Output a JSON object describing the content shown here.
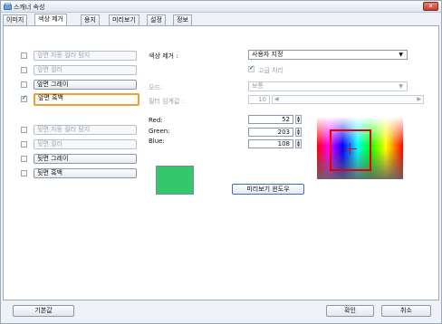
{
  "window": {
    "title": "스캐너 속성",
    "close_label": "✕"
  },
  "tabs": [
    {
      "label": "이미지"
    },
    {
      "label": "색상 제거"
    },
    {
      "label": "용지"
    },
    {
      "label": "미리보기"
    },
    {
      "label": "설정"
    },
    {
      "label": "정보"
    }
  ],
  "options": [
    {
      "label": "앞면 자동 컬러 탐지",
      "checked": false
    },
    {
      "label": "앞면 컬러",
      "checked": false
    },
    {
      "label": "앞면 그레이",
      "checked": false
    },
    {
      "label": "앞면 흑백",
      "checked": true
    },
    {
      "label": "뒷면 자동 컬러 탐지",
      "checked": false
    },
    {
      "label": "뒷면 컬러",
      "checked": false
    },
    {
      "label": "뒷면 그레이",
      "checked": false
    },
    {
      "label": "뒷면 흑백",
      "checked": false
    }
  ],
  "settings": {
    "color_remove_label": "색상 제거 :",
    "color_remove_value": "사용자 지정",
    "advanced_label": "고급 처리",
    "mode_label": "모드:",
    "mode_value": "보통",
    "filter_label": "필터 임계값 :",
    "filter_value": "10",
    "red_label": "Red:",
    "red_value": "52",
    "green_label": "Green:",
    "green_value": "203",
    "blue_label": "Blue:",
    "blue_value": "108",
    "preview_button": "미리보기 윈도우",
    "swatch_color": "#34c86c"
  },
  "footer": {
    "default_button": "기본값",
    "ok_button": "확인",
    "cancel_button": "취소"
  }
}
